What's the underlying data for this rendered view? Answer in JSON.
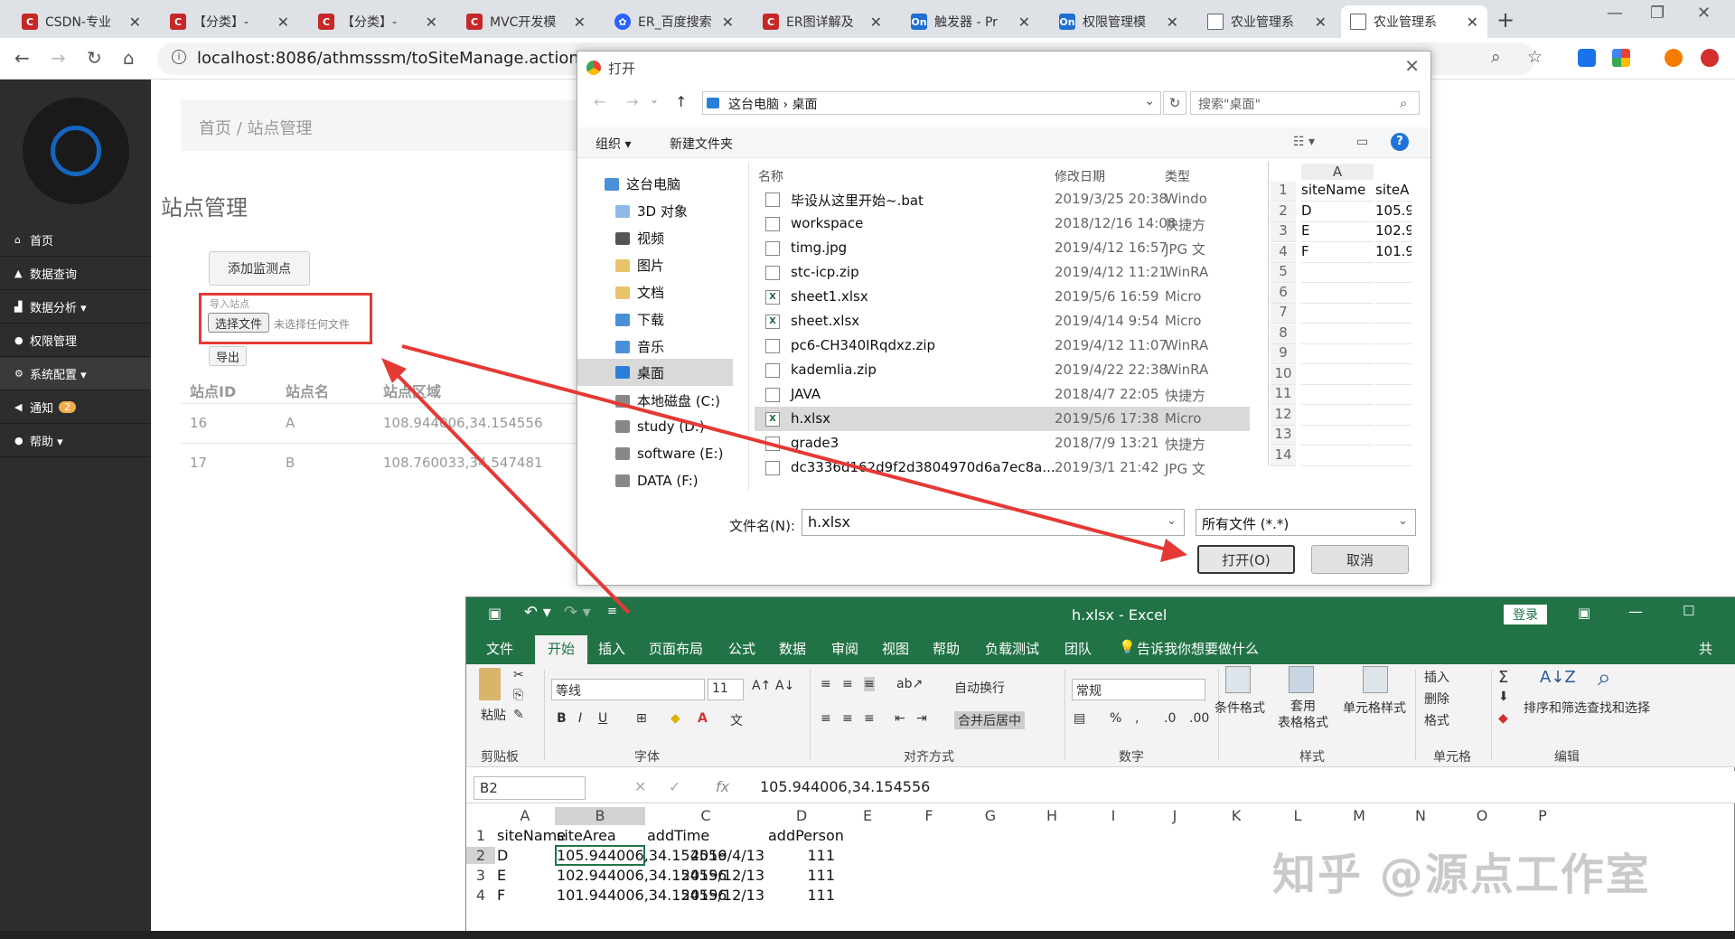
{
  "browser": {
    "tabs": [
      {
        "icon": "csdn",
        "title": "CSDN-专业"
      },
      {
        "icon": "csdn",
        "title": "【分类】-"
      },
      {
        "icon": "csdn",
        "title": "【分类】-"
      },
      {
        "icon": "csdn",
        "title": "MVC开发模"
      },
      {
        "icon": "baidu",
        "title": "ER_百度搜索"
      },
      {
        "icon": "csdn",
        "title": "ER图详解及"
      },
      {
        "icon": "on",
        "title": "触发器 - Pr"
      },
      {
        "icon": "on",
        "title": "权限管理模"
      },
      {
        "icon": "doc",
        "title": "农业管理系"
      },
      {
        "icon": "doc",
        "title": "农业管理系"
      }
    ],
    "url": "localhost:8086/athmsssm/toSiteManage.action"
  },
  "sidebar": {
    "items": [
      {
        "label": "首页",
        "icon": "home-icon"
      },
      {
        "label": "数据查询",
        "icon": "sitemap-icon"
      },
      {
        "label": "数据分析 ▾",
        "icon": "bar-chart-icon"
      },
      {
        "label": "权限管理",
        "icon": "users-icon"
      },
      {
        "label": "系统配置 ▾",
        "icon": "gears-icon"
      },
      {
        "label": "通知",
        "icon": "megaphone-icon",
        "badge": "2"
      },
      {
        "label": "帮助 ▾",
        "icon": "info-icon"
      }
    ]
  },
  "page": {
    "breadcrumb": "首页  /  站点管理",
    "title": "站点管理",
    "add_button": "添加监测点",
    "import_label": "导入站点",
    "choose_file": "选择文件",
    "no_file": "未选择任何文件",
    "export_button": "导出",
    "table": {
      "headers": [
        "站点ID",
        "站点名",
        "站点区域"
      ],
      "rows": [
        [
          "16",
          "A",
          "108.944006,34.154556"
        ],
        [
          "17",
          "B",
          "108.760033,34.547481"
        ]
      ]
    }
  },
  "dialog": {
    "title": "打开",
    "crumb": "这台电脑  ›  桌面",
    "search_placeholder": "搜索\"桌面\"",
    "organize": "组织 ▾",
    "new_folder": "新建文件夹",
    "nav": [
      "这台电脑",
      "3D 对象",
      "视频",
      "图片",
      "文档",
      "下载",
      "音乐",
      "桌面",
      "本地磁盘 (C:)",
      "study (D:)",
      "software (E:)",
      "DATA (F:)"
    ],
    "columns": [
      "名称",
      "修改日期",
      "类型"
    ],
    "files": [
      [
        "毕设从这里开始~.bat",
        "2019/3/25 20:38",
        "Windo"
      ],
      [
        "workspace",
        "2018/12/16 14:08",
        "快捷方"
      ],
      [
        "timg.jpg",
        "2019/4/12 16:57",
        "JPG 文"
      ],
      [
        "stc-icp.zip",
        "2019/4/12 11:21",
        "WinRA"
      ],
      [
        "sheet1.xlsx",
        "2019/5/6 16:59",
        "Micro"
      ],
      [
        "sheet.xlsx",
        "2019/4/14 9:54",
        "Micro"
      ],
      [
        "pc6-CH340IRqdxz.zip",
        "2019/4/12 11:07",
        "WinRA"
      ],
      [
        "kademlia.zip",
        "2019/4/22 22:38",
        "WinRA"
      ],
      [
        "JAVA",
        "2018/4/7 22:05",
        "快捷方"
      ],
      [
        "h.xlsx",
        "2019/5/6 17:38",
        "Micro"
      ],
      [
        "grade3",
        "2018/7/9 13:21",
        "快捷方"
      ],
      [
        "dc3336d162d9f2d3804970d6a7ec8a...",
        "2019/3/1 21:42",
        "JPG 文"
      ]
    ],
    "preview": {
      "col": "A",
      "rows": [
        [
          "1",
          "siteName",
          "siteA"
        ],
        [
          "2",
          "D",
          "105.9"
        ],
        [
          "3",
          "E",
          "102.9"
        ],
        [
          "4",
          "F",
          "101.9"
        ],
        [
          "5",
          "",
          ""
        ],
        [
          "6",
          "",
          ""
        ],
        [
          "7",
          "",
          ""
        ],
        [
          "8",
          "",
          ""
        ],
        [
          "9",
          "",
          ""
        ],
        [
          "10",
          "",
          ""
        ],
        [
          "11",
          "",
          ""
        ],
        [
          "12",
          "",
          ""
        ],
        [
          "13",
          "",
          ""
        ],
        [
          "14",
          "",
          ""
        ]
      ]
    },
    "filename_label": "文件名(N):",
    "filename": "h.xlsx",
    "filetype": "所有文件 (*.*)",
    "open": "打开(O)",
    "cancel": "取消"
  },
  "excel": {
    "title": "h.xlsx  -  Excel",
    "login": "登录",
    "tabs": [
      "文件",
      "开始",
      "插入",
      "页面布局",
      "公式",
      "数据",
      "审阅",
      "视图",
      "帮助",
      "负载测试",
      "团队",
      "告诉我你想要做什么",
      "共"
    ],
    "ribbon": {
      "paste": "粘贴",
      "clipboard": "剪贴板",
      "font_name": "等线",
      "font_size": "11",
      "font": "字体",
      "wrap": "自动换行",
      "merge": "合并后居中",
      "align": "对齐方式",
      "number_format": "常规",
      "number": "数字",
      "cond": "条件格式",
      "table_fmt": "套用\n表格格式",
      "cell_style": "单元格样式",
      "styles": "样式",
      "insert": "插入",
      "delete": "删除",
      "format": "格式",
      "cells": "单元格",
      "sort": "排序和筛选",
      "find": "查找和选择",
      "edit": "编辑",
      "bold": "B",
      "italic": "I",
      "underline": "U",
      "percent": "%",
      "comma": ","
    },
    "namebox": "B2",
    "formula": "105.944006,34.154556",
    "columns": [
      "A",
      "B",
      "C",
      "D",
      "E",
      "F",
      "G",
      "H",
      "I",
      "J",
      "K",
      "L",
      "M",
      "N",
      "O",
      "P"
    ],
    "rows": [
      [
        "1",
        "siteName",
        "siteArea",
        "addTime",
        "addPerson"
      ],
      [
        "2",
        "D",
        "105.944006,34.154556",
        "2019/4/13",
        "111"
      ],
      [
        "3",
        "E",
        "102.944006,34.154556",
        "2019/12/13",
        "111"
      ],
      [
        "4",
        "F",
        "101.944006,34.154556",
        "2019/12/13",
        "111"
      ]
    ],
    "watermark": "知乎 @源点工作室"
  },
  "colors": {
    "excel_green": "#217346",
    "sidebar": "#2d2d2d",
    "arrow": "#e53935"
  }
}
